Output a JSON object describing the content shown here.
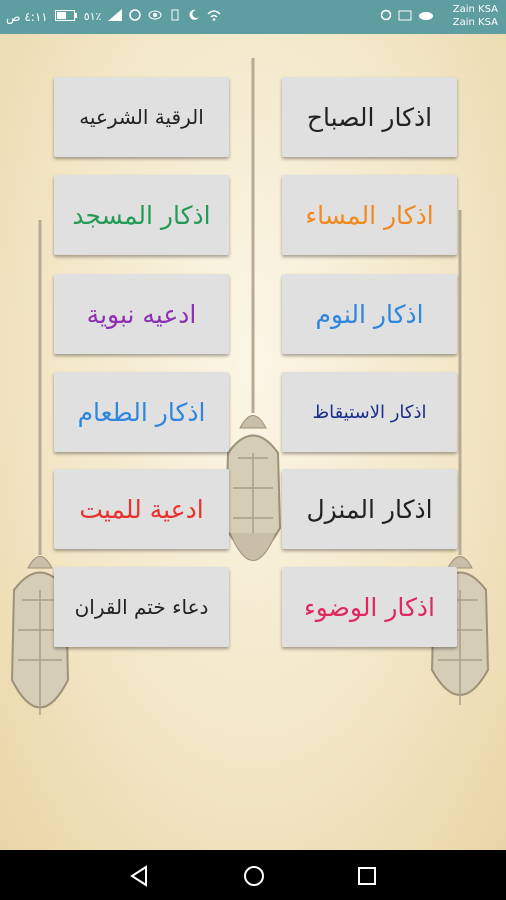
{
  "status_bar": {
    "time": "٤:١١ ص",
    "battery": "٥١٪",
    "carrier_1": "Zain KSA",
    "carrier_2": "Zain KSA",
    "icons": [
      "wifi-icon",
      "moon-icon",
      "vibrate-icon",
      "eye-icon",
      "whatsapp-icon",
      "signal-icon",
      "battery-icon",
      "cloud-icon",
      "cast-icon",
      "sync-icon"
    ]
  },
  "buttons": {
    "morning": {
      "label": "اذكار الصباح",
      "color": "#222222"
    },
    "evening": {
      "label": "اذكار المساء",
      "color": "#f0891e"
    },
    "sleep": {
      "label": "اذكار النوم",
      "color": "#2e86de"
    },
    "waking": {
      "label": "اذكار الاستيقاظ",
      "color": "#1a2f8a"
    },
    "home": {
      "label": "اذكار المنزل",
      "color": "#222222"
    },
    "ablution": {
      "label": "اذكار الوضوء",
      "color": "#e0285e"
    },
    "ruqyah": {
      "label": "الرقية الشرعيه",
      "color": "#222222"
    },
    "mosque": {
      "label": "اذكار المسجد",
      "color": "#239b56"
    },
    "prophetic": {
      "label": "ادعيه نبوية",
      "color": "#8e2fb3"
    },
    "food": {
      "label": "اذكار الطعام",
      "color": "#2e86de"
    },
    "deceased": {
      "label": "ادعية للميت",
      "color": "#e8312a"
    },
    "quran_completion": {
      "label": "دعاء ختم القران",
      "color": "#222222"
    }
  },
  "navigation": {
    "back": "back-icon",
    "home": "home-icon",
    "recents": "recents-icon"
  }
}
